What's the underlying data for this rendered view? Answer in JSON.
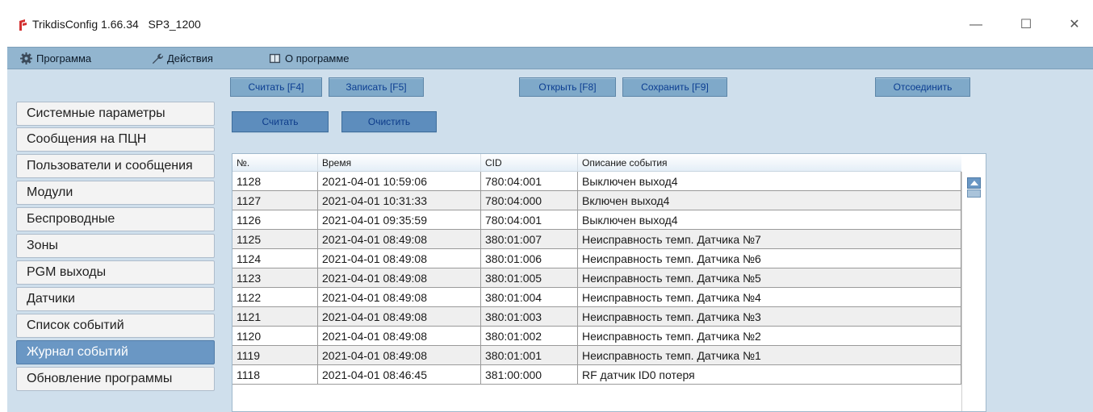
{
  "window": {
    "title": "TrikdisConfig 1.66.34   SP3_1200",
    "controls": {
      "minimize": "—",
      "maximize": "☐",
      "close": "✕"
    }
  },
  "menu": [
    {
      "label": "Программа",
      "icon": "gear-icon"
    },
    {
      "label": "Действия",
      "icon": "wrench-icon"
    },
    {
      "label": "О программе",
      "icon": "book-icon"
    }
  ],
  "toolbar": {
    "read": "Считать [F4]",
    "write": "Записать [F5]",
    "open": "Открыть [F8]",
    "save": "Сохранить [F9]",
    "disconnect": "Отсоединить"
  },
  "log_actions": {
    "read": "Считать",
    "clear": "Очистить"
  },
  "sidebar": {
    "items": [
      {
        "label": "Системные параметры"
      },
      {
        "label": "Сообщения на ПЦН"
      },
      {
        "label": "Пользователи и сообщения"
      },
      {
        "label": "Модули"
      },
      {
        "label": "Беспроводные"
      },
      {
        "label": "Зоны"
      },
      {
        "label": "PGM выходы"
      },
      {
        "label": "Датчики"
      },
      {
        "label": "Список событий"
      },
      {
        "label": "Журнал событий",
        "active": true
      },
      {
        "label": "Обновление программы"
      }
    ]
  },
  "table": {
    "columns": [
      "№.",
      "Время",
      "CID",
      "Описание события"
    ],
    "rows": [
      [
        "1128",
        "2021-04-01 10:59:06",
        "780:04:001",
        "Выключен выход4"
      ],
      [
        "1127",
        "2021-04-01 10:31:33",
        "780:04:000",
        "Включен выход4"
      ],
      [
        "1126",
        "2021-04-01 09:35:59",
        "780:04:001",
        "Выключен выход4"
      ],
      [
        "1125",
        "2021-04-01 08:49:08",
        "380:01:007",
        "Неисправность темп. Датчика №7"
      ],
      [
        "1124",
        "2021-04-01 08:49:08",
        "380:01:006",
        "Неисправность темп. Датчика №6"
      ],
      [
        "1123",
        "2021-04-01 08:49:08",
        "380:01:005",
        "Неисправность темп. Датчика №5"
      ],
      [
        "1122",
        "2021-04-01 08:49:08",
        "380:01:004",
        "Неисправность темп. Датчика №4"
      ],
      [
        "1121",
        "2021-04-01 08:49:08",
        "380:01:003",
        "Неисправность темп. Датчика №3"
      ],
      [
        "1120",
        "2021-04-01 08:49:08",
        "380:01:002",
        "Неисправность темп. Датчика №2"
      ],
      [
        "1119",
        "2021-04-01 08:49:08",
        "380:01:001",
        "Неисправность темп. Датчика №1"
      ],
      [
        "1118",
        "2021-04-01 08:46:45",
        "381:00:000",
        "RF датчик ID0 потеря"
      ]
    ]
  },
  "colors": {
    "menubar": "#92b5cf",
    "client_bg": "#cfdfec",
    "active_item": "#6a97c4",
    "button_text": "#0b3d91"
  }
}
